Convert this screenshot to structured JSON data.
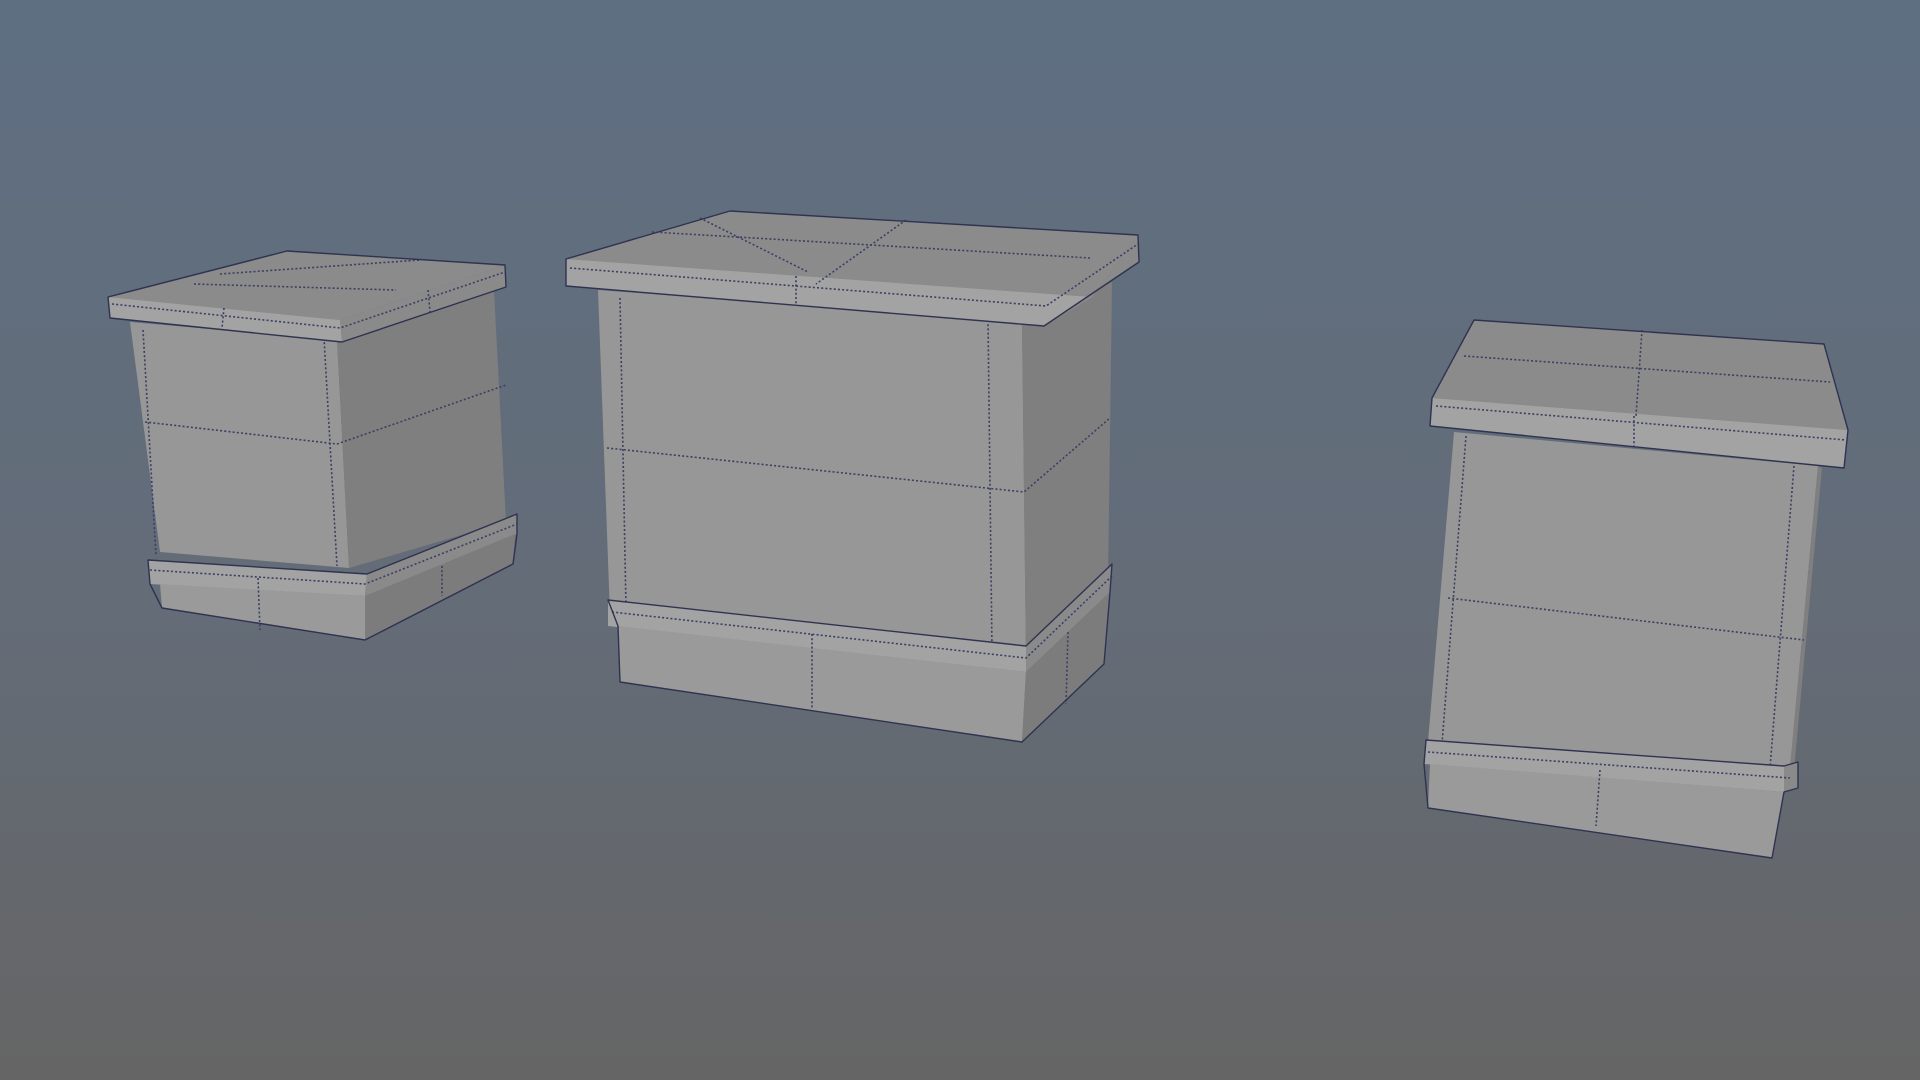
{
  "app": {
    "view": "3D viewport",
    "display_mode": "wireframe-on-shaded"
  },
  "scene": {
    "background_gradient": {
      "top": "#5e6f82",
      "middle": "#646c78",
      "bottom": "#656565"
    },
    "objects": [
      {
        "name": "crate-left",
        "selected": false
      },
      {
        "name": "crate-center",
        "selected": false
      },
      {
        "name": "crate-right",
        "selected": false
      }
    ],
    "colors": {
      "mesh_gray": "#979797",
      "wire_edge": "#3b3f63"
    }
  }
}
